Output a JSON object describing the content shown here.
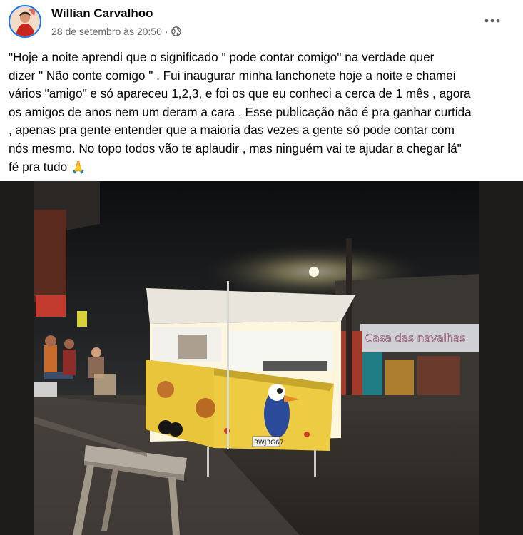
{
  "post": {
    "author": "Willian Carvalhoo",
    "timestamp": "28 de setembro às 20:50",
    "separator": "·",
    "privacy_icon": "globe-icon",
    "more_icon": "more-options-icon",
    "text_lines": [
      "\"Hoje a noite aprendi que o significado \" pode contar comigo\" na verdade quer",
      "dizer \" Não conte comigo \" . Fui inaugurar minha lanchonete hoje a noite  e chamei",
      "vários \"amigo\" e só apareceu 1,2,3, e foi os que eu conheci a cerca de 1 mês , agora",
      "os amigos de anos nem um deram a cara . Esse publicação não é pra ganhar curtida",
      ", apenas pra gente entender que a maioria das vezes a  gente só pode contar com",
      "nós mesmo. No topo todos vão te aplaudir , mas ninguém vai te ajudar a chegar lá\"",
      "fé pra tudo 🙏"
    ]
  },
  "photo": {
    "store_sign": "Casa das navalhas",
    "license_plate": "RWJ3G67"
  },
  "colors": {
    "accent": "#1877f2",
    "secondary_text": "#65676b",
    "trailer_yellow": "#e8c53a"
  }
}
